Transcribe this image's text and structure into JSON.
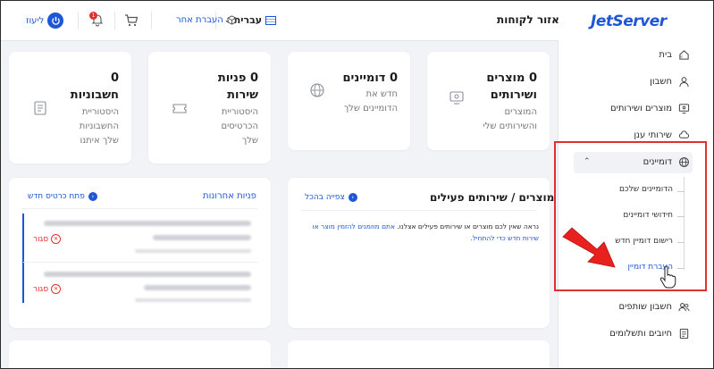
{
  "header": {
    "logo": "JetServer",
    "area_title": "אזור לקוחות",
    "language": "עברית",
    "transfer_other": "העברת אחר",
    "notif_count": "1",
    "user_name": "ליעוז"
  },
  "sidebar": {
    "items": [
      {
        "label": "בית",
        "icon": "home-icon"
      },
      {
        "label": "חשבון",
        "icon": "user-icon"
      },
      {
        "label": "מוצרים ושירותים",
        "icon": "monitor-icon"
      },
      {
        "label": "שירותי ענן",
        "icon": "cloud-icon"
      },
      {
        "label": "דומיינים",
        "icon": "globe-icon"
      },
      {
        "label": "חשבון שותפים",
        "icon": "users-icon"
      },
      {
        "label": "חיובים ותשלומים",
        "icon": "invoice-icon"
      }
    ],
    "domain_sub": [
      "הדומיינים שלכם",
      "חידושי דומיינים",
      "רישום דומיין חדש",
      "העברת דומיין"
    ]
  },
  "stats": [
    {
      "title1": "0 מוצרים",
      "title2": "ושירותים",
      "sub1": "המוצרים",
      "sub2": "והשירותים שלי",
      "sub3": ""
    },
    {
      "title1": "0 דומיינים",
      "title2": "",
      "sub1": "חדש את",
      "sub2": "הדומיינים שלך",
      "sub3": ""
    },
    {
      "title1": "0 פניות",
      "title2": "שירות",
      "sub1": "היסטוריית",
      "sub2": "הכרטיסים",
      "sub3": "שלך"
    },
    {
      "title1": "0",
      "title2": "חשבוניות",
      "sub1": "היסטוריית",
      "sub2": "החשבוניות",
      "sub3": "שלך איתנו"
    }
  ],
  "products_panel": {
    "title": "מוצרים / שירותים פעילים",
    "view_all": "צפייה בהכל",
    "note_text": "נראה שאין לכם מוצרים או שירותים פעילים אצלנו. ",
    "note_link": "אתם מוזמנים להזמין מוצר או שירות חדש כדי להתחיל."
  },
  "tickets_panel": {
    "title": "פניות אחרונות",
    "new_ticket": "פתח כרטיס חדש",
    "rows": [
      {
        "status": "סגור"
      },
      {
        "status": "סגור"
      }
    ]
  },
  "colors": {
    "accent": "#1e56d6",
    "danger": "#e0312f",
    "background": "#f2f3f7"
  }
}
